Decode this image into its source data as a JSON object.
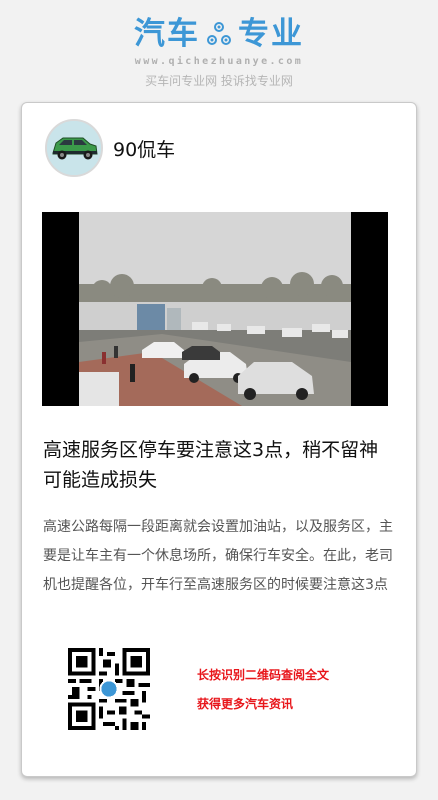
{
  "header": {
    "logo_left": "汽车",
    "logo_right": "专业",
    "domain": "www.qichezhuanye.com",
    "slogan": "买车问专业网 投诉找专业网"
  },
  "colors": {
    "brand": "#3d97d6",
    "cta": "#e8161b",
    "background": "#f2f2f2"
  },
  "icons": {
    "logo_mark": "gear-icon",
    "qr": "qr-code-icon"
  },
  "article": {
    "author": "90侃车",
    "title": "高速服务区停车要注意这3点，稍不留神可能造成损失",
    "summary": "高速公路每隔一段距离就会设置加油站，以及服务区，主要是让车主有一个休息场所，确保行车安全。在此，老司机也提醒各位，开车行至高速服务区的时候要注意这3点"
  },
  "cta": {
    "line1": "长按识别二维码查阅全文",
    "line2": "获得更多汽车资讯"
  }
}
